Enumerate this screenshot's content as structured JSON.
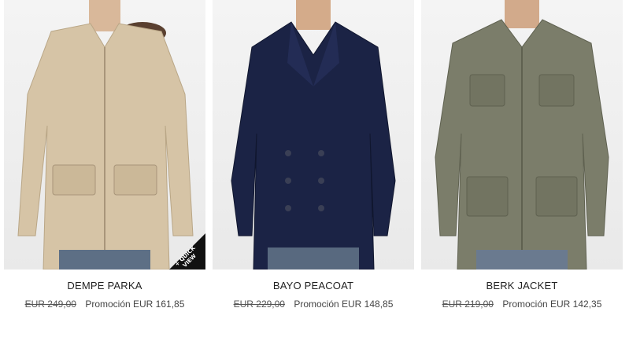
{
  "products": [
    {
      "name": "DEMPE PARKA",
      "old_price": "EUR 249,00",
      "promo_price": "Promoción EUR 161,85",
      "color": "#d6c4a6"
    },
    {
      "name": "BAYO PEACOAT",
      "old_price": "EUR 229,00",
      "promo_price": "Promoción EUR 148,85",
      "color": "#1b2345"
    },
    {
      "name": "BERK JACKET",
      "old_price": "EUR 219,00",
      "promo_price": "Promoción EUR 142,35",
      "color": "#7b7d6a"
    }
  ],
  "quick_view": {
    "line1": "+ QUICK",
    "line2": "VIEW"
  }
}
